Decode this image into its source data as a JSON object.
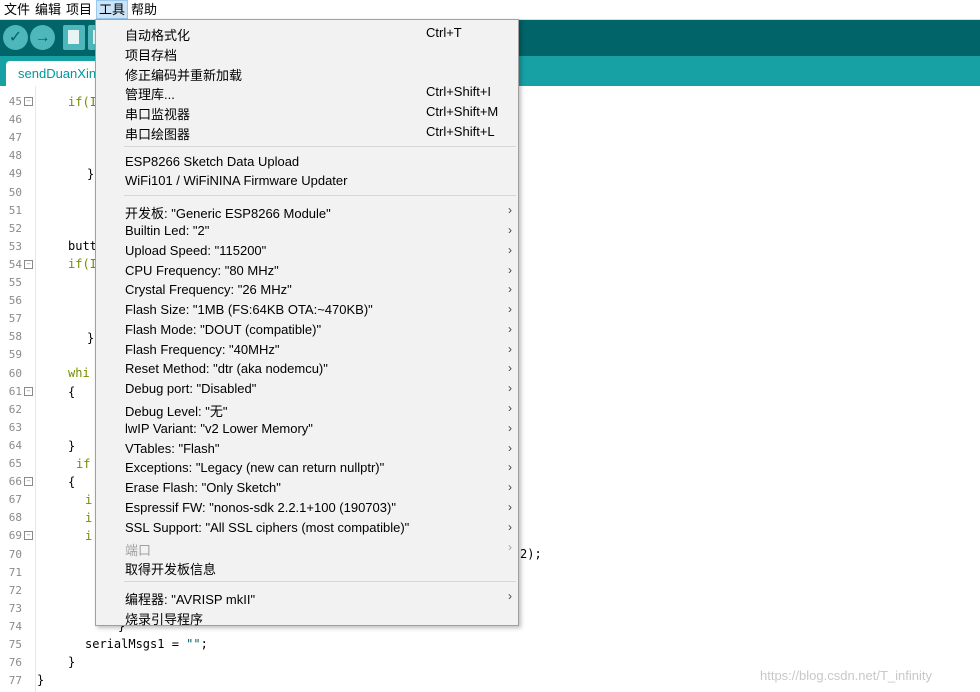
{
  "menubar": {
    "items": [
      "文件",
      "编辑",
      "项目",
      "工具",
      "帮助"
    ],
    "active_index": 3
  },
  "toolbar": {
    "buttons": [
      "verify-icon",
      "upload-icon",
      "new-icon",
      "open-icon"
    ]
  },
  "tabs": {
    "active": "sendDuanXin"
  },
  "editor": {
    "line_numbers": [
      "45",
      "46",
      "47",
      "48",
      "49",
      "50",
      "51",
      "52",
      "53",
      "54",
      "55",
      "56",
      "57",
      "58",
      "59",
      "60",
      "61",
      "62",
      "63",
      "64",
      "65",
      "66",
      "67",
      "68",
      "69",
      "70",
      "71",
      "72",
      "73",
      "74",
      "75",
      "76",
      "77"
    ],
    "code_fragments": {
      "l45": "if(I",
      "l49": "}",
      "l53": "butt",
      "l54": "if(I",
      "l58": "}",
      "l60": "whi",
      "l61": "{",
      "l64": "}",
      "l65": "if",
      "l66": "{",
      "l67": "i",
      "l68": "i",
      "l69": "i",
      "l70": "2);",
      "l74": "}",
      "l75_a": "serialMsgs1 = ",
      "l75_b": "\"\"",
      "l75_c": ";",
      "l76": "}",
      "l77": "}"
    }
  },
  "tools_menu": {
    "groups": [
      [
        {
          "label": "自动格式化",
          "shortcut": "Ctrl+T"
        },
        {
          "label": "项目存档",
          "shortcut": ""
        },
        {
          "label": "修正编码并重新加载",
          "shortcut": ""
        },
        {
          "label": "管理库...",
          "shortcut": "Ctrl+Shift+I"
        },
        {
          "label": "串口监视器",
          "shortcut": "Ctrl+Shift+M"
        },
        {
          "label": "串口绘图器",
          "shortcut": "Ctrl+Shift+L"
        }
      ],
      [
        {
          "label": "ESP8266 Sketch Data Upload"
        },
        {
          "label": "WiFi101 / WiFiNINA Firmware Updater"
        }
      ],
      [
        {
          "label": "开发板: \"Generic ESP8266 Module\"",
          "submenu": true
        },
        {
          "label": "Builtin Led: \"2\"",
          "submenu": true
        },
        {
          "label": "Upload Speed: \"115200\"",
          "submenu": true
        },
        {
          "label": "CPU Frequency: \"80 MHz\"",
          "submenu": true
        },
        {
          "label": "Crystal Frequency: \"26 MHz\"",
          "submenu": true
        },
        {
          "label": "Flash Size: \"1MB (FS:64KB OTA:~470KB)\"",
          "submenu": true
        },
        {
          "label": "Flash Mode: \"DOUT (compatible)\"",
          "submenu": true
        },
        {
          "label": "Flash Frequency: \"40MHz\"",
          "submenu": true
        },
        {
          "label": "Reset Method: \"dtr (aka nodemcu)\"",
          "submenu": true
        },
        {
          "label": "Debug port: \"Disabled\"",
          "submenu": true
        },
        {
          "label": "Debug Level: \"无\"",
          "submenu": true
        },
        {
          "label": "lwIP Variant: \"v2 Lower Memory\"",
          "submenu": true
        },
        {
          "label": "VTables: \"Flash\"",
          "submenu": true
        },
        {
          "label": "Exceptions: \"Legacy (new can return nullptr)\"",
          "submenu": true
        },
        {
          "label": "Erase Flash: \"Only Sketch\"",
          "submenu": true
        },
        {
          "label": "Espressif FW: \"nonos-sdk 2.2.1+100 (190703)\"",
          "submenu": true
        },
        {
          "label": "SSL Support: \"All SSL ciphers (most compatible)\"",
          "submenu": true
        },
        {
          "label": "端口",
          "submenu": true,
          "disabled": true
        },
        {
          "label": "取得开发板信息"
        }
      ],
      [
        {
          "label": "编程器: \"AVRISP mkII\"",
          "submenu": true
        },
        {
          "label": "烧录引导程序"
        }
      ]
    ],
    "submenu_arrow": "›"
  },
  "watermark": "https://blog.csdn.net/T_infinity",
  "colors": {
    "toolbar": "#006468",
    "tabstrip": "#17a1a5",
    "menu_bg": "#f2f2f2"
  }
}
